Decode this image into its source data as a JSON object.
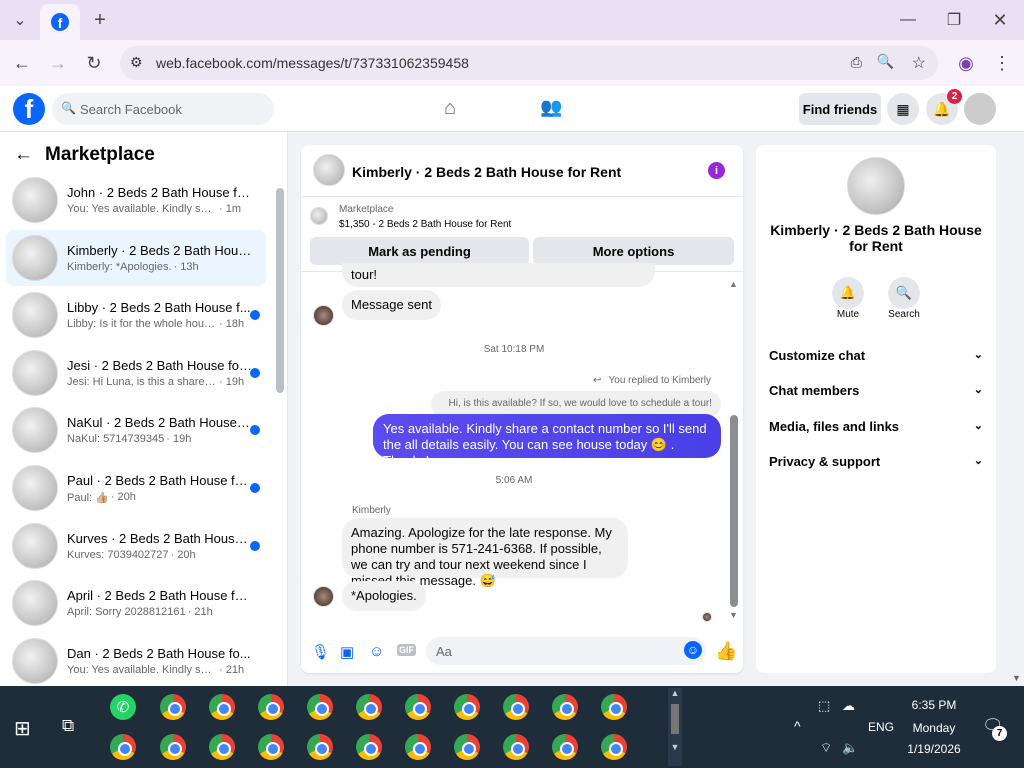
{
  "browser": {
    "url": "web.facebook.com/messages/t/737331062359458",
    "icons": [
      "tab-list-icon",
      "facebook-tab-icon",
      "new-tab-icon",
      "minimize-icon",
      "restore-icon",
      "close-icon",
      "back-icon",
      "forward-icon",
      "reload-icon",
      "site-info-icon",
      "install-app-icon",
      "zoom-icon",
      "bookmark-star-icon",
      "profile-icon",
      "menu-icon"
    ]
  },
  "header": {
    "search_placeholder": "Search Facebook",
    "find_friends": "Find friends",
    "notif_count": "2"
  },
  "left": {
    "title": "Marketplace",
    "threads": [
      {
        "name": "John · 2 Beds 2 Bath House for ...",
        "preview": "You: Yes available. Kindly share a c...",
        "time": "· 1m",
        "unread": false,
        "active": false
      },
      {
        "name": "Kimberly · 2 Beds 2 Bath House ...",
        "preview": "Kimberly: *Apologies.",
        "time": "· 13h",
        "unread": false,
        "active": true
      },
      {
        "name": "Libby · 2 Beds 2 Bath House f...",
        "preview": "Libby: Is it for the whole hous...",
        "time": "· 18h",
        "unread": true,
        "active": false
      },
      {
        "name": "Jesi · 2 Beds 2 Bath House for ...",
        "preview": "Jesi: Hi Luna, is this a shared s...",
        "time": "· 19h",
        "unread": true,
        "active": false
      },
      {
        "name": "NaKul · 2 Beds 2 Bath House f...",
        "preview": "NaKul: 5714739345",
        "time": "· 19h",
        "unread": true,
        "active": false
      },
      {
        "name": "Paul · 2 Beds 2 Bath House for...",
        "preview": "Paul: 👍🏼",
        "time": "· 20h",
        "unread": true,
        "active": false
      },
      {
        "name": "Kurves · 2 Beds 2 Bath House ...",
        "preview": "Kurves: 7039402727",
        "time": "· 20h",
        "unread": true,
        "active": false
      },
      {
        "name": "April · 2 Beds 2 Bath House for ...",
        "preview": "April: Sorry 2028812161",
        "time": "· 21h",
        "unread": false,
        "active": false
      },
      {
        "name": "Dan · 2 Beds 2 Bath House fo...",
        "preview": "You: Yes available. Kindly share...",
        "time": "· 21h",
        "unread": false,
        "active": false
      }
    ]
  },
  "chat": {
    "title": "Kimberly · 2 Beds 2 Bath House for Rent",
    "listing_label": "Marketplace",
    "listing_text": "$1,350 - 2 Beds 2 Bath House for Rent",
    "mark_pending": "Mark as pending",
    "more_options": "More options",
    "partial_text": "tour!",
    "msg_sent": "Message sent",
    "time1": "Sat 10:18 PM",
    "replied_to": "You replied to Kimberly",
    "quoted": "Hi, is this available? If so, we would love to schedule a tour!",
    "my_msg": "Yes available. Kindly share a contact number so I'll send the all details easily. You can see house today 😊 . Thanks!",
    "time2": "5:06 AM",
    "sender": "Kimberly",
    "their_msg": "Amazing. Apologize for the late response. My phone number is 571-241-6368. If possible, we can try and tour next weekend since I missed this message. 😅",
    "apologies": "*Apologies.",
    "composer_placeholder": "Aa"
  },
  "info": {
    "title": "Kimberly · 2 Beds 2 Bath House for Rent",
    "mute": "Mute",
    "search": "Search",
    "options": [
      "Customize chat",
      "Chat members",
      "Media, files and links",
      "Privacy & support"
    ]
  },
  "taskbar": {
    "lang": "ENG",
    "time": "6:35 PM",
    "day": "Monday",
    "date": "1/19/2026",
    "notif_count": "7"
  }
}
